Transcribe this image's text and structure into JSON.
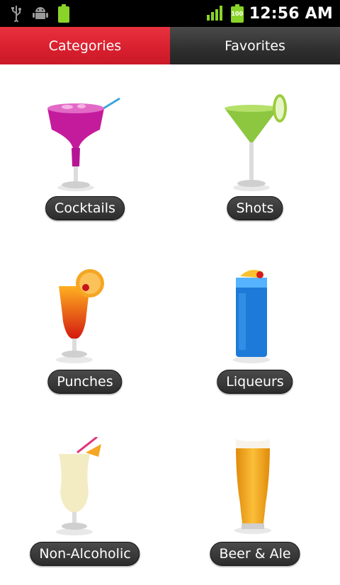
{
  "status_bar": {
    "time": "12:56 AM",
    "battery_level": "100"
  },
  "tabs": [
    {
      "label": "Categories",
      "active": true
    },
    {
      "label": "Favorites",
      "active": false
    }
  ],
  "categories": [
    {
      "label": "Cocktails",
      "drink": "margarita-icon"
    },
    {
      "label": "Shots",
      "drink": "martini-icon"
    },
    {
      "label": "Punches",
      "drink": "hurricane-glass-icon"
    },
    {
      "label": "Liqueurs",
      "drink": "blue-highball-icon"
    },
    {
      "label": "Non-Alcoholic",
      "drink": "pina-colada-icon"
    },
    {
      "label": "Beer & Ale",
      "drink": "beer-glass-icon"
    }
  ],
  "colors": {
    "active_tab": "#d81f2e",
    "inactive_tab": "#2f2f2f",
    "label_pill": "#3a3a3a"
  }
}
